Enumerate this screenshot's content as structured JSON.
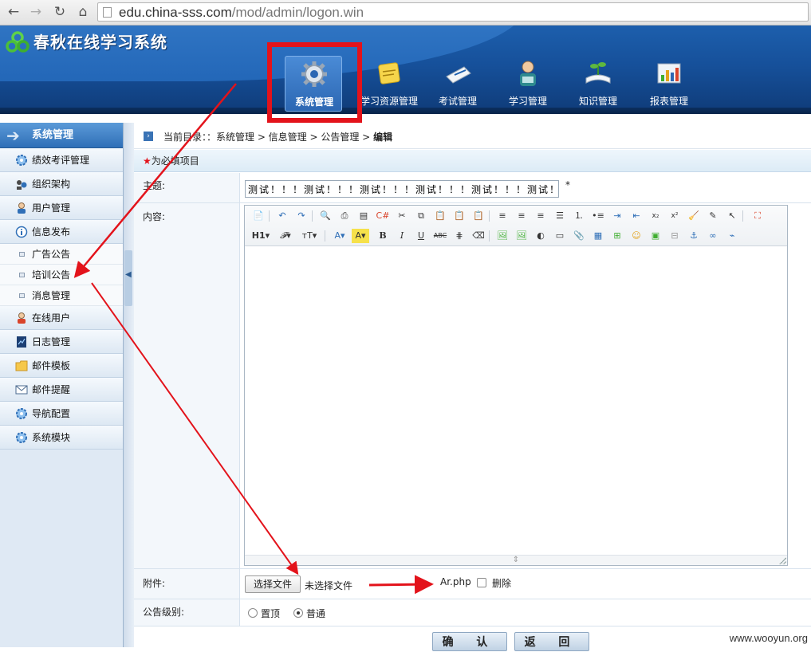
{
  "browser": {
    "back_icon": "arrow-left-icon",
    "forward_icon": "arrow-right-icon",
    "reload_icon": "reload-icon",
    "home_icon": "home-icon",
    "url_host": "edu.china-sss.com",
    "url_path": "/mod/admin/logon.win"
  },
  "app": {
    "title": "春秋在线学习系统",
    "logo_icon": "trefoil-logo-icon"
  },
  "top_nav": [
    {
      "label": "系统管理",
      "icon": "gear-icon",
      "active": true
    },
    {
      "label": "学习资源管理",
      "icon": "note-icon"
    },
    {
      "label": "考试管理",
      "icon": "paper-pen-icon"
    },
    {
      "label": "学习管理",
      "icon": "person-icon"
    },
    {
      "label": "知识管理",
      "icon": "book-plant-icon"
    },
    {
      "label": "报表管理",
      "icon": "chart-icon"
    }
  ],
  "sidebar": {
    "header": "系统管理",
    "items": [
      {
        "label": "绩效考评管理",
        "icon": "gear-icon"
      },
      {
        "label": "组织架构",
        "icon": "org-icon"
      },
      {
        "label": "用户管理",
        "icon": "user-icon"
      },
      {
        "label": "信息发布",
        "icon": "info-icon"
      },
      {
        "label": "广告公告",
        "sub": true
      },
      {
        "label": "培训公告",
        "sub": true
      },
      {
        "label": "消息管理",
        "sub": true
      },
      {
        "label": "在线用户",
        "icon": "online-user-icon"
      },
      {
        "label": "日志管理",
        "icon": "log-icon"
      },
      {
        "label": "邮件模板",
        "icon": "folder-icon"
      },
      {
        "label": "邮件提醒",
        "icon": "mail-icon"
      },
      {
        "label": "导航配置",
        "icon": "gear-icon"
      },
      {
        "label": "系统模块",
        "icon": "gear-icon"
      }
    ]
  },
  "breadcrumb": {
    "prefix": "当前目录：：系统管理 > 信息管理 > 公告管理 > ",
    "current": "编辑"
  },
  "form": {
    "required_star": "★",
    "required_note": "为必填项目",
    "subject_label": "主题:",
    "subject_value": "测试！！！测试！！！测试！！！测试！！！测试！！！测试！！！",
    "subject_required_mark": "*",
    "content_label": "内容:",
    "attachment_label": "附件:",
    "file_button": "选择文件",
    "file_none": "未选择文件",
    "attached_file": "Ar.php",
    "delete_label": "删除",
    "level_label": "公告级别:",
    "level_options": [
      "置顶",
      "普通"
    ],
    "level_selected": "普通",
    "confirm_button": "确 认",
    "back_button": "返 回"
  },
  "watermark": "www.wooyun.org",
  "colors": {
    "header_blue": "#16509a",
    "highlight_red": "#e3131b",
    "annotation_arrow": "#e3131b"
  }
}
